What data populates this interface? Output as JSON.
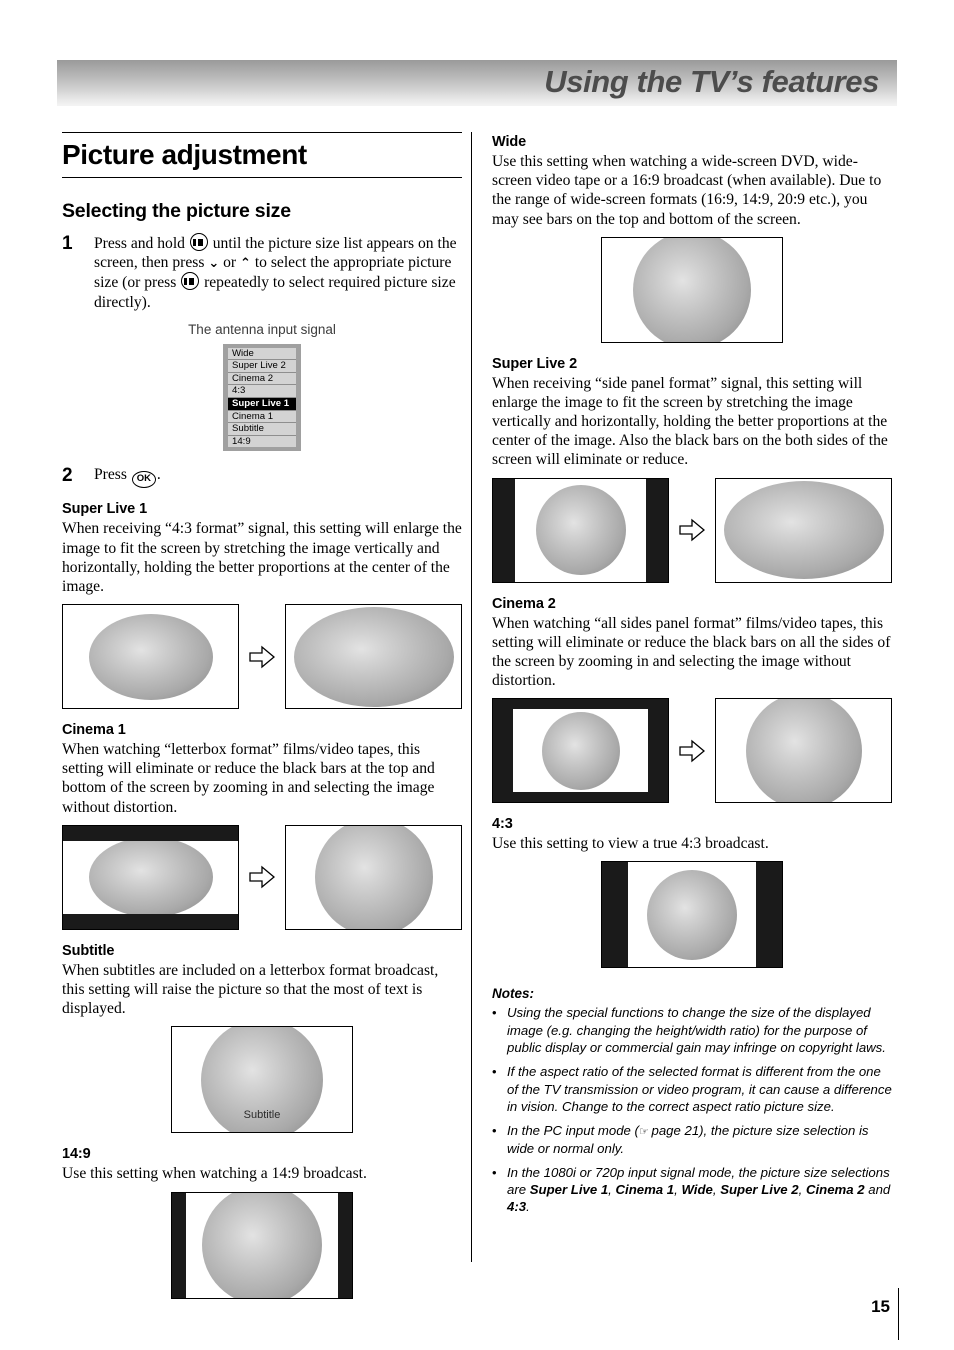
{
  "header": {
    "title": "Using the TV’s features"
  },
  "page": {
    "heading": "Picture adjustment",
    "section_heading": "Selecting the picture size",
    "number": "15"
  },
  "steps": [
    {
      "num": "1",
      "t1": "Press and hold ",
      "t2": " until the picture size list appears on the screen, then press ",
      "chev_down": "⌄",
      "t3": " or ",
      "chev_up": "⌃",
      "t4": " to select the appropriate picture size (or press ",
      "t5": " repeatedly to select required picture size directly)."
    },
    {
      "num": "2",
      "t1": "Press ",
      "ok": "OK",
      "t2": "."
    }
  ],
  "osd": {
    "caption": "The antenna input signal",
    "items": [
      {
        "label": "Wide",
        "selected": false
      },
      {
        "label": "Super Live 2",
        "selected": false
      },
      {
        "label": "Cinema 2",
        "selected": false
      },
      {
        "label": "4:3",
        "selected": false
      },
      {
        "label": "Super Live 1",
        "selected": true
      },
      {
        "label": "Cinema 1",
        "selected": false
      },
      {
        "label": "Subtitle",
        "selected": false
      },
      {
        "label": "14:9",
        "selected": false
      }
    ]
  },
  "sections": {
    "super_live_1": {
      "title": "Super Live 1",
      "body": "When receiving “4:3 format” signal, this setting will enlarge the image to fit the screen by stretching the image vertically and horizontally, holding the better proportions at the center of the image."
    },
    "cinema_1": {
      "title": "Cinema 1",
      "body": "When watching “letterbox format” films/video tapes, this setting will eliminate or reduce the black bars at the top and bottom of the screen by zooming in and selecting the image without distortion."
    },
    "subtitle": {
      "title": "Subtitle",
      "body": "When subtitles are included on a letterbox format broadcast, this setting will raise the picture so that the most of text is displayed.",
      "screen_label": "Subtitle"
    },
    "ratio_14_9": {
      "title": "14:9",
      "body": "Use this setting when watching a 14:9 broadcast."
    },
    "wide": {
      "title": "Wide",
      "body": "Use this setting when watching a wide-screen DVD, wide-screen video tape or a 16:9 broadcast (when available). Due to the range of wide-screen formats (16:9, 14:9, 20:9 etc.), you may see bars on the top and bottom of the screen."
    },
    "super_live_2": {
      "title": "Super Live 2",
      "body": "When receiving “side panel format” signal, this setting will enlarge the image to fit the screen by stretching the image vertically and horizontally, holding the better proportions at the center of the image. Also the black bars on the both sides of the screen will eliminate or reduce."
    },
    "cinema_2": {
      "title": "Cinema 2",
      "body": "When watching “all sides panel format” films/video tapes, this setting will eliminate or reduce the black bars on all the sides of the screen by zooming in and selecting the image without distortion."
    },
    "ratio_4_3": {
      "title": "4:3",
      "body": "Use this setting to view a true 4:3 broadcast."
    }
  },
  "notes": {
    "title": "Notes:",
    "bullet": "•",
    "items": [
      {
        "text": "Using the special functions to change the size of the displayed image (e.g. changing the height/width ratio) for the purpose of public display or commercial gain may infringe on copyright laws."
      },
      {
        "text": "If the aspect ratio of the selected format is different from the one of the TV transmission or video program, it can cause a difference in vision. Change to the correct aspect ratio picture size."
      },
      {
        "pre": "In the PC input mode (",
        "icon": "☞",
        "post": " page 21), the picture size selection is wide or normal only."
      },
      {
        "pre": "In the 1080i or 720p input signal mode, the picture size selections are ",
        "bold_list": [
          "Super Live 1",
          "Cinema 1",
          "Wide",
          "Super Live 2",
          "Cinema 2"
        ],
        "conj": " and ",
        "last_bold": "4:3",
        "post": "."
      }
    ]
  }
}
